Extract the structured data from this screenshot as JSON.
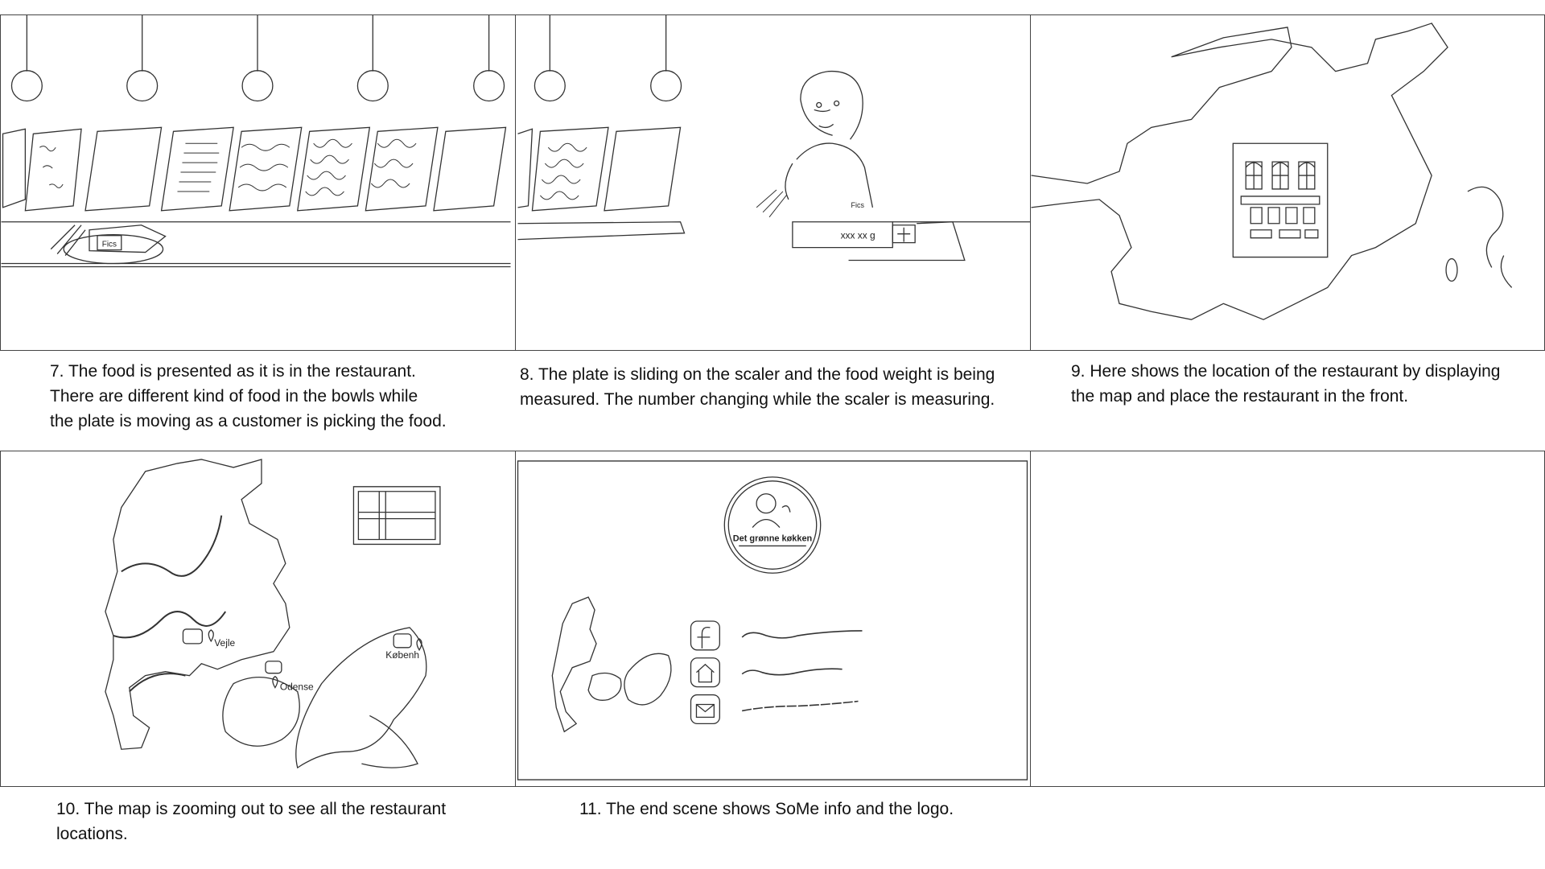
{
  "panels": [
    {
      "caption_lines": [
        "7. The food is presented as it is in the restaurant.",
        "There are different kind of food in the bowls while",
        "the plate is moving as a customer is picking the food."
      ],
      "plate_label": "Fics"
    },
    {
      "caption_lines": [
        "8. The plate is sliding on the scaler and the  food weight is being",
        "measured. The number changing while the scaler is measuring."
      ],
      "scale_readout": "xxx xx g",
      "plate_label": "Fics"
    },
    {
      "caption_lines": [
        "9. Here shows the location of the restaurant by displaying",
        "the map and place the restaurant in the front."
      ]
    },
    {
      "caption_lines": [
        "10. The map is zooming out to see all the restaurant",
        "locations."
      ],
      "city_labels": [
        "Vejle",
        "Odense",
        "Københ"
      ]
    },
    {
      "caption_lines": [
        "11. The end scene shows SoMe info and the logo."
      ],
      "logo_text": "Det grønne køkken",
      "social_icons": [
        "facebook-icon",
        "home-icon",
        "mail-icon"
      ]
    }
  ]
}
